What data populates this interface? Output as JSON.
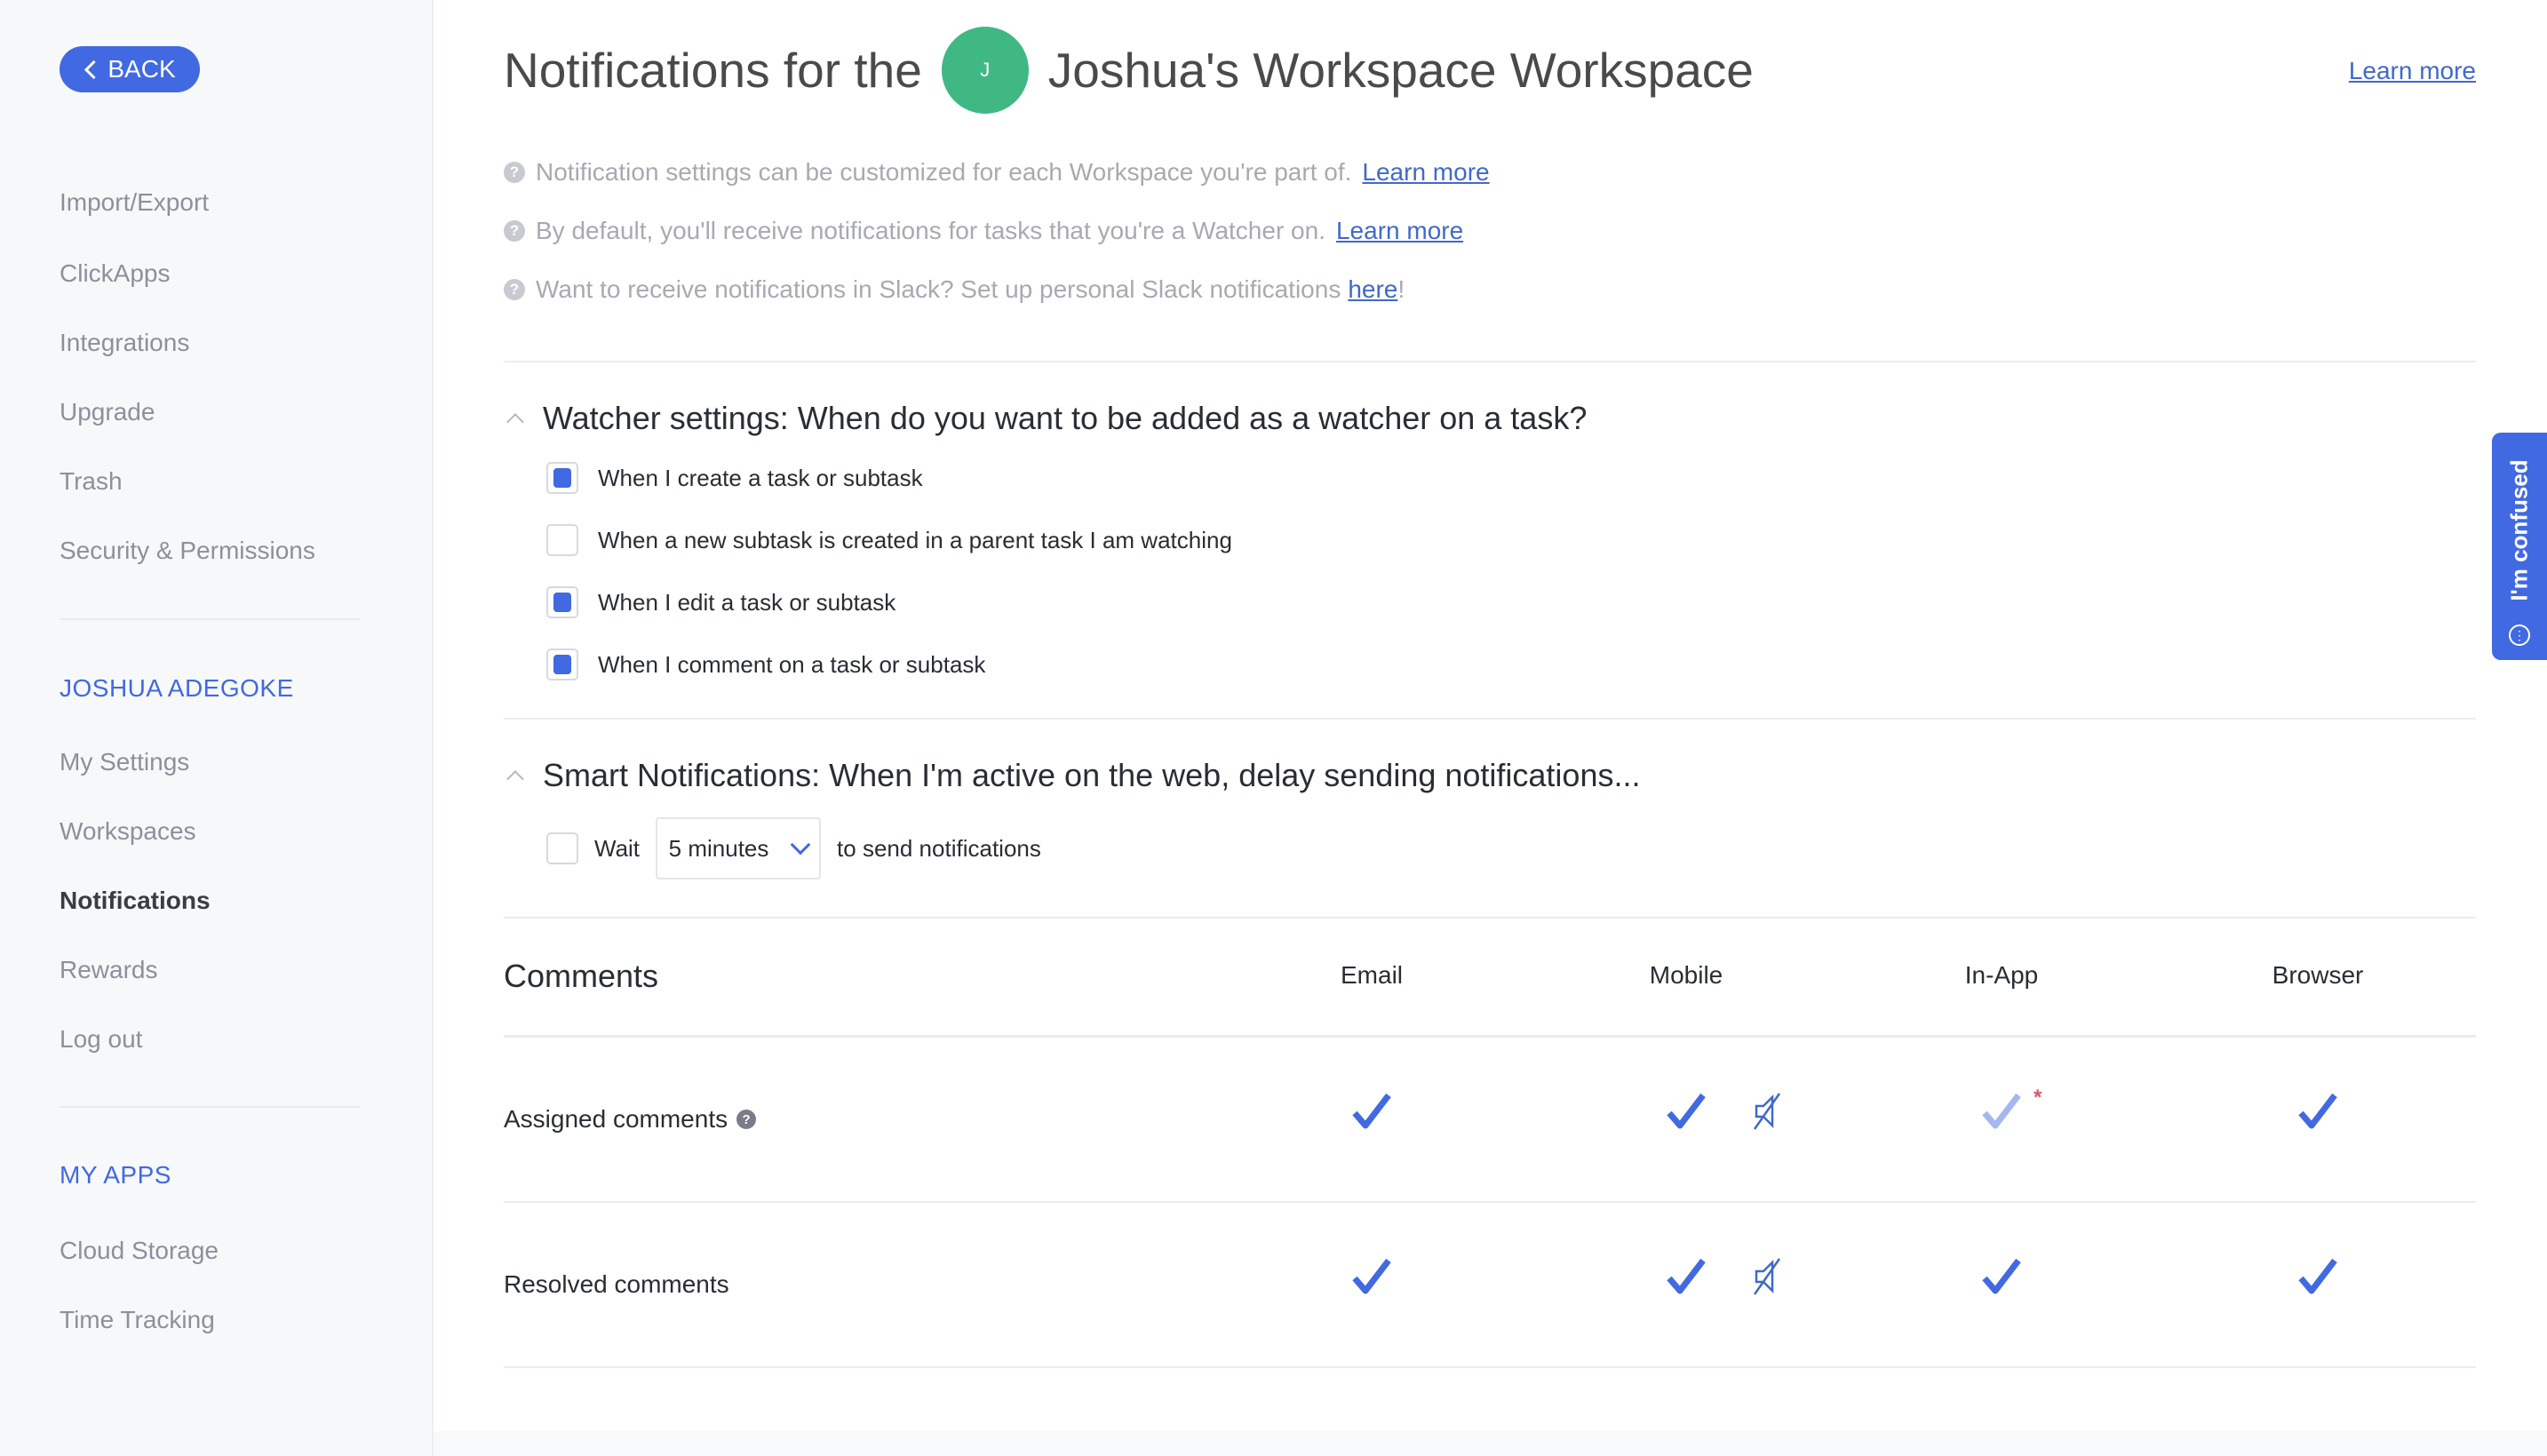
{
  "sidebar": {
    "back_label": "BACK",
    "items_top": [
      "Import/Export",
      "ClickApps",
      "Integrations",
      "Upgrade",
      "Trash",
      "Security & Permissions"
    ],
    "user_heading": "JOSHUA ADEGOKE",
    "user_items": [
      "My Settings",
      "Workspaces",
      "Notifications",
      "Rewards",
      "Log out"
    ],
    "active_item": "Notifications",
    "apps_heading": "MY APPS",
    "apps_items": [
      "Cloud Storage",
      "Time Tracking"
    ]
  },
  "header": {
    "title_prefix": "Notifications for the",
    "avatar_initial": "J",
    "workspace_name": "Joshua's Workspace Workspace",
    "learn_more": "Learn more"
  },
  "info": [
    {
      "text": "Notification settings can be customized for each Workspace you're part of.",
      "link": "Learn more",
      "suffix": ""
    },
    {
      "text": "By default, you'll receive notifications for tasks that you're a Watcher on.",
      "link": "Learn more",
      "suffix": ""
    },
    {
      "text": "Want to receive notifications in Slack? Set up personal Slack notifications",
      "link": "here",
      "suffix": "!"
    }
  ],
  "watcher": {
    "title": "Watcher settings: When do you want to be added as a watcher on a task?",
    "options": [
      {
        "label": "When I create a task or subtask",
        "checked": true
      },
      {
        "label": "When a new subtask is created in a parent task I am watching",
        "checked": false
      },
      {
        "label": "When I edit a task or subtask",
        "checked": true
      },
      {
        "label": "When I comment on a task or subtask",
        "checked": true
      }
    ]
  },
  "smart": {
    "title": "Smart Notifications: When I'm active on the web, delay sending notifications...",
    "wait_label": "Wait",
    "wait_checked": false,
    "delay_value": "5 minutes",
    "suffix": "to send notifications"
  },
  "comments_table": {
    "title": "Comments",
    "columns": [
      "Email",
      "Mobile",
      "In-App",
      "Browser"
    ],
    "rows": [
      {
        "label": "Assigned comments",
        "help": true,
        "email": true,
        "mobile": true,
        "mobile_muted_icon": true,
        "inapp": "partial-required",
        "browser": true
      },
      {
        "label": "Resolved comments",
        "help": false,
        "email": true,
        "mobile": true,
        "mobile_muted_icon": true,
        "inapp": true,
        "browser": true
      }
    ]
  },
  "help_widget": {
    "label": "I'm confused"
  },
  "colors": {
    "accent": "#4169e1",
    "avatar": "#3fb884",
    "required_star": "#e05565",
    "check_light": "#a4b7f0"
  }
}
